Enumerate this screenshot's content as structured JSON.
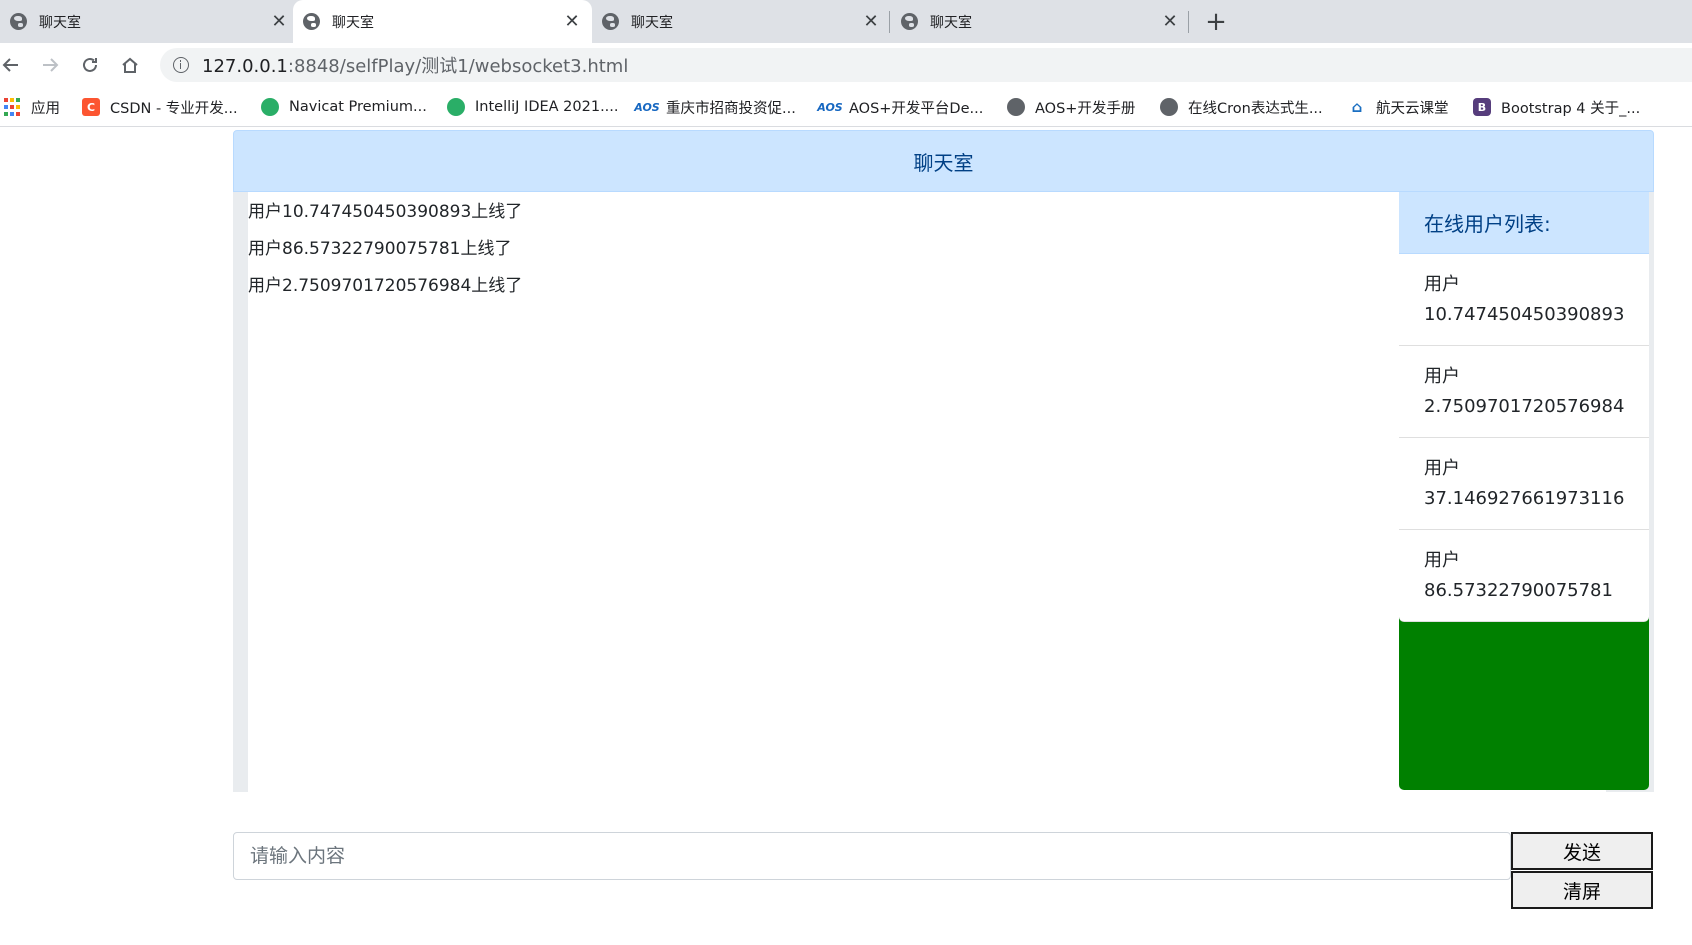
{
  "browser": {
    "tabs": [
      {
        "title": "聊天室",
        "active": false
      },
      {
        "title": "聊天室",
        "active": true
      },
      {
        "title": "聊天室",
        "active": false
      },
      {
        "title": "聊天室",
        "active": false
      }
    ],
    "url_host": "127.0.0.1",
    "url_rest": ":8848/selfPlay/测试1/websocket3.html",
    "bookmarks": [
      {
        "label": "应用",
        "icon": "apps-grid-icon"
      },
      {
        "label": "CSDN - 专业开发...",
        "icon": "csdn-icon"
      },
      {
        "label": "Navicat Premium...",
        "icon": "wechat-icon"
      },
      {
        "label": "IntelliJ IDEA 2021....",
        "icon": "wechat-icon"
      },
      {
        "label": "重庆市招商投资促...",
        "icon": "aos-icon"
      },
      {
        "label": "AOS+开发平台De...",
        "icon": "aos-icon"
      },
      {
        "label": "AOS+开发手册",
        "icon": "globe-icon"
      },
      {
        "label": "在线Cron表达式生...",
        "icon": "globe-icon"
      },
      {
        "label": "航天云课堂",
        "icon": "sky-icon"
      },
      {
        "label": "Bootstrap 4 关于_...",
        "icon": "bootstrap-icon"
      }
    ],
    "icon_glyphs": {
      "csdn": "C",
      "aos": "AOS",
      "sky": "⌂",
      "bootstrap": "B"
    }
  },
  "chat": {
    "title": "聊天室",
    "messages": [
      "用户10.747450450390893上线了",
      "用户86.57322790075781上线了",
      "用户2.7509701720576984上线了"
    ],
    "online_title": "在线用户列表:",
    "online_users": [
      {
        "prefix": "用户",
        "id": "10.747450450390893"
      },
      {
        "prefix": "用户",
        "id": "2.7509701720576984"
      },
      {
        "prefix": "用户",
        "id": "37.146927661973116"
      },
      {
        "prefix": "用户",
        "id": "86.57322790075781"
      }
    ],
    "input_placeholder": "请输入内容",
    "send_label": "发送",
    "clear_label": "清屏"
  },
  "colors": {
    "header_bg": "#cce5ff",
    "header_text": "#004085",
    "user_panel_bg": "#008000"
  }
}
